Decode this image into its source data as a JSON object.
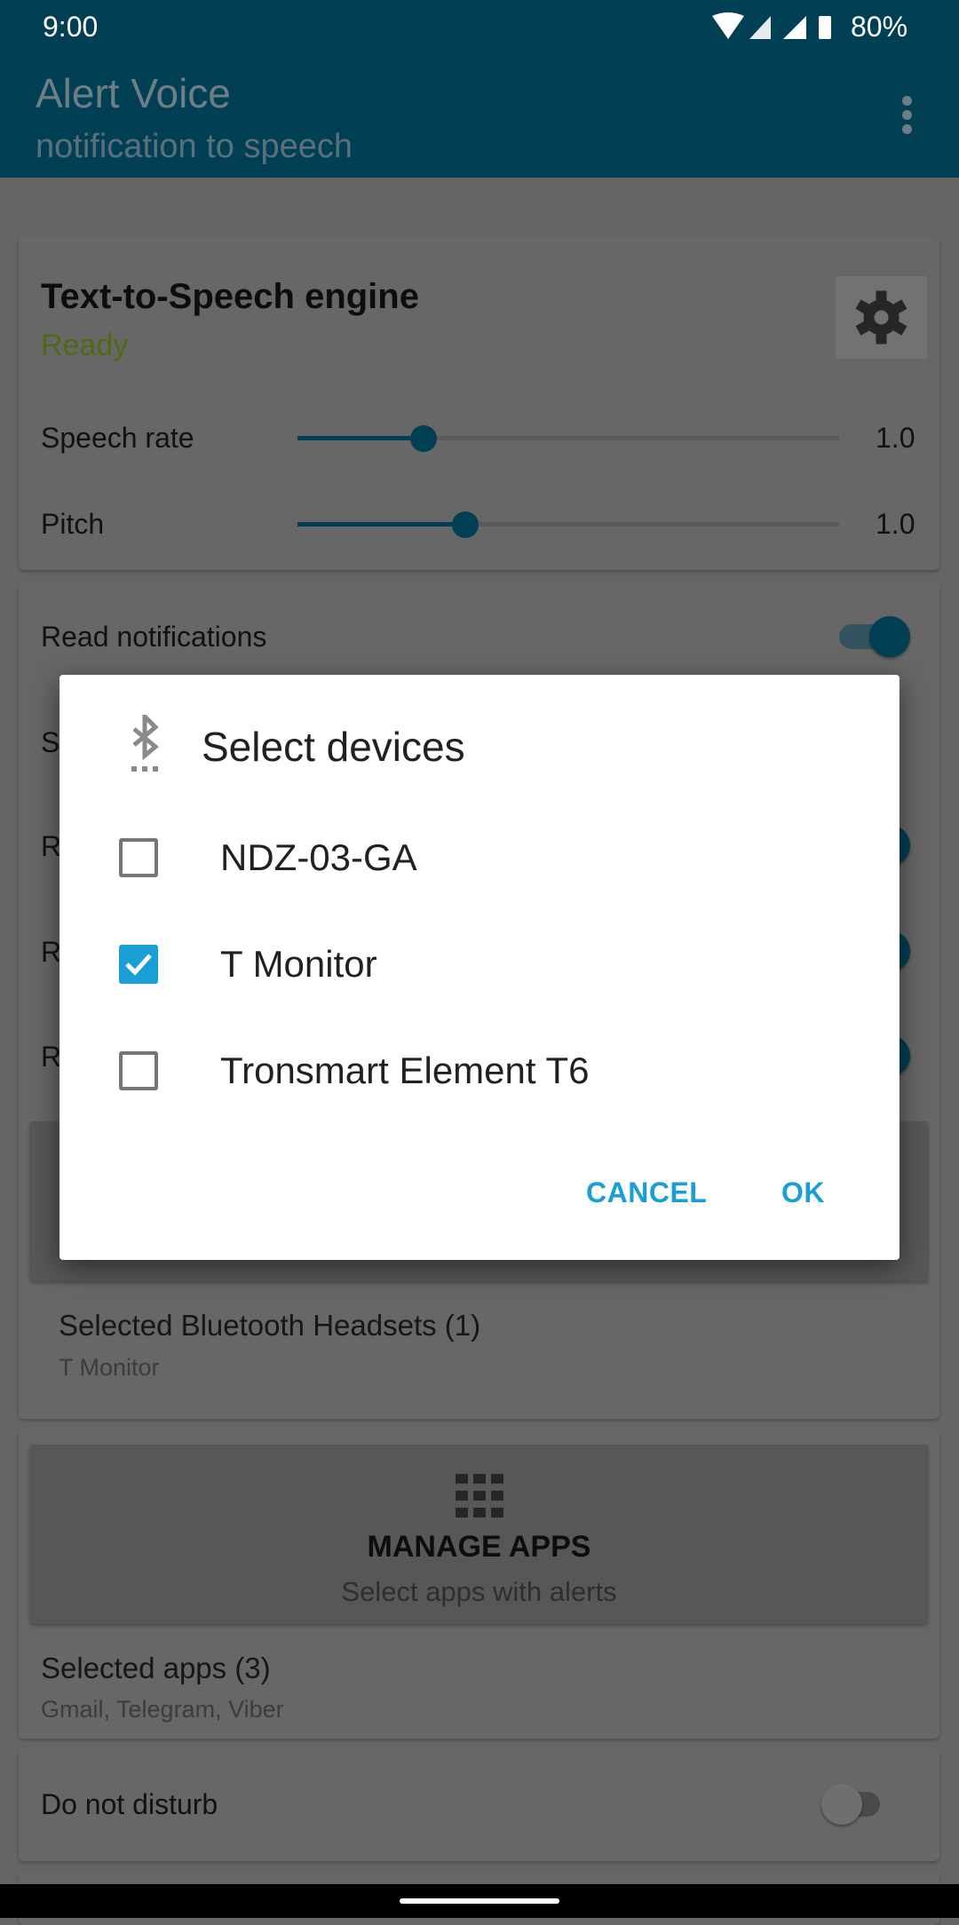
{
  "status_bar": {
    "time": "9:00",
    "battery": "80%"
  },
  "app_bar": {
    "title": "Alert Voice",
    "subtitle": "notification to speech",
    "menu_icon": "more-vert-icon"
  },
  "tts_card": {
    "title": "Text-to-Speech engine",
    "status": "Ready",
    "status_color": "#4f6a12",
    "speech_rate": {
      "label": "Speech rate",
      "value": "1.0",
      "slider_fraction": 0.23
    },
    "pitch": {
      "label": "Pitch",
      "value": "1.0",
      "slider_fraction": 0.31
    }
  },
  "settings_card": {
    "read_notifications": {
      "label": "Read notifications",
      "on": true
    },
    "partial_rows": [
      "S",
      "R",
      "R",
      "R"
    ],
    "headsets": {
      "label": "Selected Bluetooth Headsets (1)",
      "value": "T Monitor"
    }
  },
  "apps_card": {
    "button_title": "MANAGE APPS",
    "button_subtitle": "Select apps with alerts",
    "selected_label": "Selected apps (3)",
    "selected_value": "Gmail, Telegram, Viber"
  },
  "dnd": {
    "label": "Do not disturb",
    "on": false
  },
  "dialog": {
    "title": "Select devices",
    "icon": "bluetooth-searching-icon",
    "devices": [
      {
        "name": "NDZ-03-GA",
        "checked": false
      },
      {
        "name": "T Monitor",
        "checked": true
      },
      {
        "name": "Tronsmart Element T6",
        "checked": false
      }
    ],
    "cancel": "CANCEL",
    "ok": "OK",
    "accent": "#1a9ed6"
  }
}
